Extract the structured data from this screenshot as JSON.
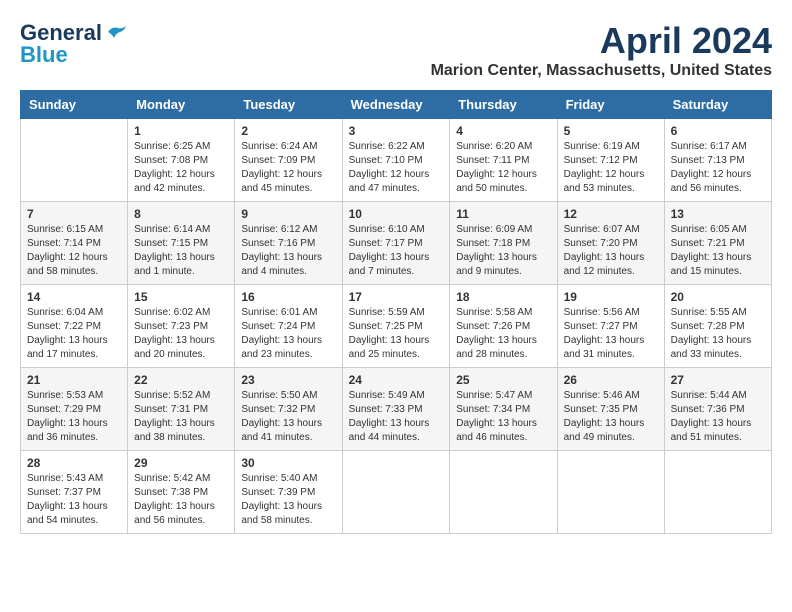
{
  "header": {
    "logo_line1": "General",
    "logo_line2": "Blue",
    "month": "April 2024",
    "location": "Marion Center, Massachusetts, United States"
  },
  "weekdays": [
    "Sunday",
    "Monday",
    "Tuesday",
    "Wednesday",
    "Thursday",
    "Friday",
    "Saturday"
  ],
  "weeks": [
    [
      {
        "day": "",
        "info": ""
      },
      {
        "day": "1",
        "info": "Sunrise: 6:25 AM\nSunset: 7:08 PM\nDaylight: 12 hours\nand 42 minutes."
      },
      {
        "day": "2",
        "info": "Sunrise: 6:24 AM\nSunset: 7:09 PM\nDaylight: 12 hours\nand 45 minutes."
      },
      {
        "day": "3",
        "info": "Sunrise: 6:22 AM\nSunset: 7:10 PM\nDaylight: 12 hours\nand 47 minutes."
      },
      {
        "day": "4",
        "info": "Sunrise: 6:20 AM\nSunset: 7:11 PM\nDaylight: 12 hours\nand 50 minutes."
      },
      {
        "day": "5",
        "info": "Sunrise: 6:19 AM\nSunset: 7:12 PM\nDaylight: 12 hours\nand 53 minutes."
      },
      {
        "day": "6",
        "info": "Sunrise: 6:17 AM\nSunset: 7:13 PM\nDaylight: 12 hours\nand 56 minutes."
      }
    ],
    [
      {
        "day": "7",
        "info": "Sunrise: 6:15 AM\nSunset: 7:14 PM\nDaylight: 12 hours\nand 58 minutes."
      },
      {
        "day": "8",
        "info": "Sunrise: 6:14 AM\nSunset: 7:15 PM\nDaylight: 13 hours\nand 1 minute."
      },
      {
        "day": "9",
        "info": "Sunrise: 6:12 AM\nSunset: 7:16 PM\nDaylight: 13 hours\nand 4 minutes."
      },
      {
        "day": "10",
        "info": "Sunrise: 6:10 AM\nSunset: 7:17 PM\nDaylight: 13 hours\nand 7 minutes."
      },
      {
        "day": "11",
        "info": "Sunrise: 6:09 AM\nSunset: 7:18 PM\nDaylight: 13 hours\nand 9 minutes."
      },
      {
        "day": "12",
        "info": "Sunrise: 6:07 AM\nSunset: 7:20 PM\nDaylight: 13 hours\nand 12 minutes."
      },
      {
        "day": "13",
        "info": "Sunrise: 6:05 AM\nSunset: 7:21 PM\nDaylight: 13 hours\nand 15 minutes."
      }
    ],
    [
      {
        "day": "14",
        "info": "Sunrise: 6:04 AM\nSunset: 7:22 PM\nDaylight: 13 hours\nand 17 minutes."
      },
      {
        "day": "15",
        "info": "Sunrise: 6:02 AM\nSunset: 7:23 PM\nDaylight: 13 hours\nand 20 minutes."
      },
      {
        "day": "16",
        "info": "Sunrise: 6:01 AM\nSunset: 7:24 PM\nDaylight: 13 hours\nand 23 minutes."
      },
      {
        "day": "17",
        "info": "Sunrise: 5:59 AM\nSunset: 7:25 PM\nDaylight: 13 hours\nand 25 minutes."
      },
      {
        "day": "18",
        "info": "Sunrise: 5:58 AM\nSunset: 7:26 PM\nDaylight: 13 hours\nand 28 minutes."
      },
      {
        "day": "19",
        "info": "Sunrise: 5:56 AM\nSunset: 7:27 PM\nDaylight: 13 hours\nand 31 minutes."
      },
      {
        "day": "20",
        "info": "Sunrise: 5:55 AM\nSunset: 7:28 PM\nDaylight: 13 hours\nand 33 minutes."
      }
    ],
    [
      {
        "day": "21",
        "info": "Sunrise: 5:53 AM\nSunset: 7:29 PM\nDaylight: 13 hours\nand 36 minutes."
      },
      {
        "day": "22",
        "info": "Sunrise: 5:52 AM\nSunset: 7:31 PM\nDaylight: 13 hours\nand 38 minutes."
      },
      {
        "day": "23",
        "info": "Sunrise: 5:50 AM\nSunset: 7:32 PM\nDaylight: 13 hours\nand 41 minutes."
      },
      {
        "day": "24",
        "info": "Sunrise: 5:49 AM\nSunset: 7:33 PM\nDaylight: 13 hours\nand 44 minutes."
      },
      {
        "day": "25",
        "info": "Sunrise: 5:47 AM\nSunset: 7:34 PM\nDaylight: 13 hours\nand 46 minutes."
      },
      {
        "day": "26",
        "info": "Sunrise: 5:46 AM\nSunset: 7:35 PM\nDaylight: 13 hours\nand 49 minutes."
      },
      {
        "day": "27",
        "info": "Sunrise: 5:44 AM\nSunset: 7:36 PM\nDaylight: 13 hours\nand 51 minutes."
      }
    ],
    [
      {
        "day": "28",
        "info": "Sunrise: 5:43 AM\nSunset: 7:37 PM\nDaylight: 13 hours\nand 54 minutes."
      },
      {
        "day": "29",
        "info": "Sunrise: 5:42 AM\nSunset: 7:38 PM\nDaylight: 13 hours\nand 56 minutes."
      },
      {
        "day": "30",
        "info": "Sunrise: 5:40 AM\nSunset: 7:39 PM\nDaylight: 13 hours\nand 58 minutes."
      },
      {
        "day": "",
        "info": ""
      },
      {
        "day": "",
        "info": ""
      },
      {
        "day": "",
        "info": ""
      },
      {
        "day": "",
        "info": ""
      }
    ]
  ]
}
